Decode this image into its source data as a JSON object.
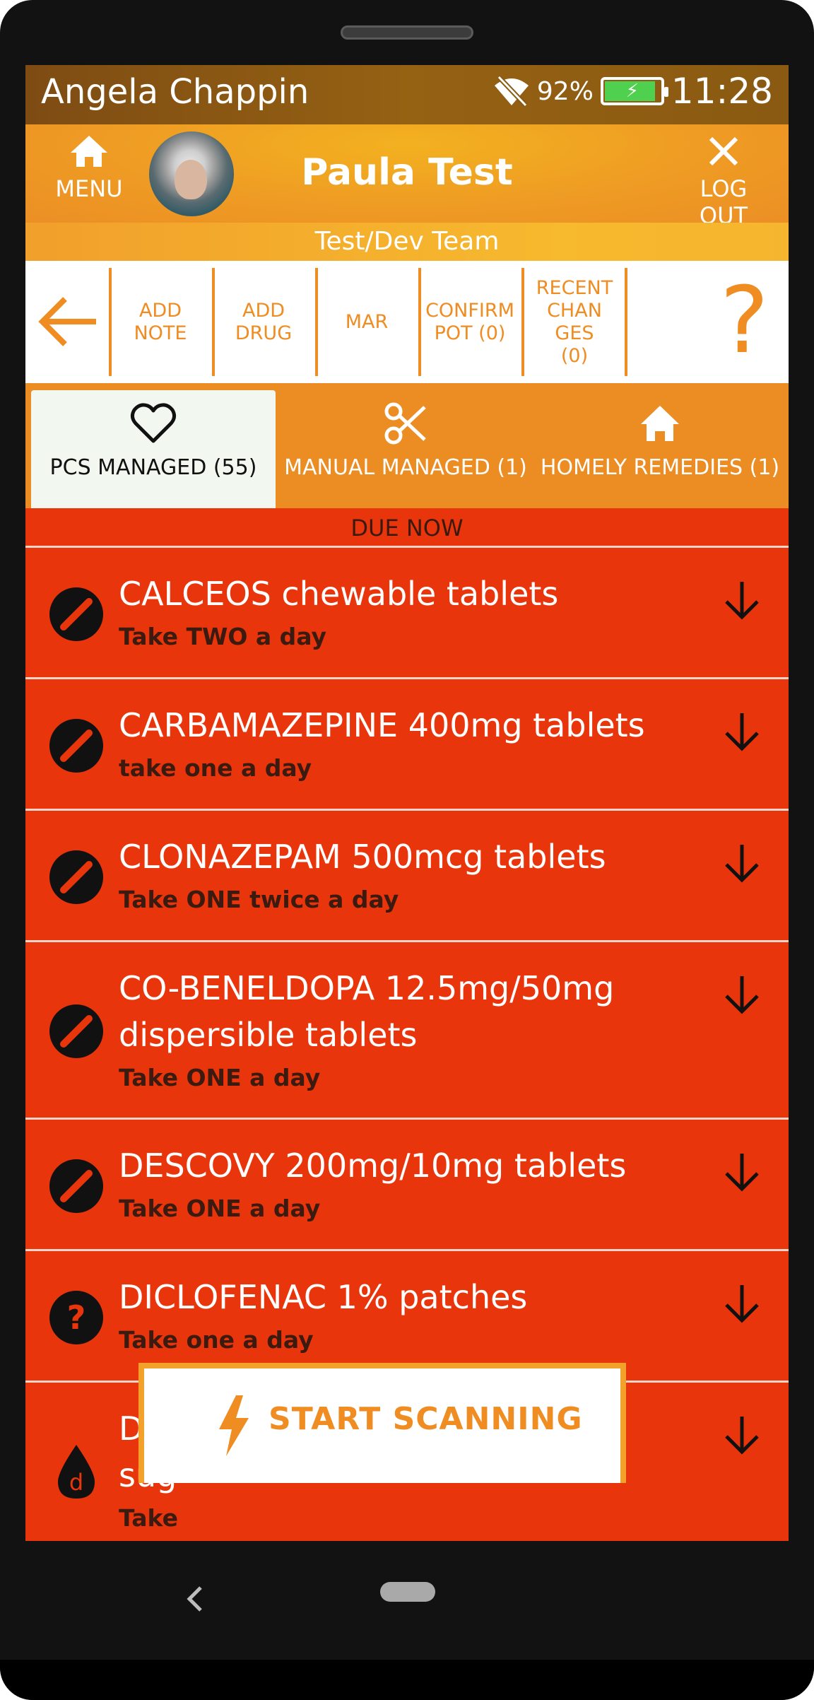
{
  "status_bar": {
    "user_name": "Angela Chappin",
    "battery_percent": "92%",
    "battery_level": 0.92,
    "time": "11:28",
    "icons": [
      "wifi-off-icon",
      "battery-charging-icon"
    ]
  },
  "header": {
    "menu_label": "MENU",
    "logout_label": "LOG OUT",
    "patient_name": "Paula Test",
    "team": "Test/Dev Team",
    "colors": {
      "accent": "#ef8c22",
      "header": "#ee9a24"
    }
  },
  "toolbar": {
    "items": [
      {
        "line1": "ADD",
        "line2": "NOTE",
        "line3": "",
        "line4": ""
      },
      {
        "line1": "ADD",
        "line2": "DRUG",
        "line3": "",
        "line4": ""
      },
      {
        "line1": "MAR",
        "line2": "",
        "line3": "",
        "line4": ""
      },
      {
        "line1": "CONFIRM",
        "line2": "POT (0)",
        "line3": "",
        "line4": ""
      },
      {
        "line1": "RECENT",
        "line2": "CHAN",
        "line3": "GES",
        "line4": "(0)"
      }
    ],
    "help": "?"
  },
  "tabs": [
    {
      "label": "PCS MANAGED (55)",
      "icon": "heart-icon",
      "active": true
    },
    {
      "label": "MANUAL MANAGED (1)",
      "icon": "scissors-icon",
      "active": false
    },
    {
      "label": "HOMELY REMEDIES (1)",
      "icon": "home-icon",
      "active": false
    }
  ],
  "section_title": "DUE NOW",
  "medications": [
    {
      "name_line1": "CALCEOS chewable tablets",
      "name_line2": "",
      "dose": "Take TWO a day",
      "icon": "tablet-icon"
    },
    {
      "name_line1": "CARBAMAZEPINE 400mg tablets",
      "name_line2": "",
      "dose": "take one a day",
      "icon": "tablet-icon"
    },
    {
      "name_line1": "CLONAZEPAM 500mcg tablets",
      "name_line2": "",
      "dose": "Take ONE twice a day",
      "icon": "tablet-icon"
    },
    {
      "name_line1": "CO-BENELDOPA 12.5mg/50mg",
      "name_line2": "dispersible tablets",
      "dose": "Take ONE a day",
      "icon": "tablet-icon"
    },
    {
      "name_line1": "DESCOVY 200mg/10mg tablets",
      "name_line2": "",
      "dose": "Take ONE a day",
      "icon": "tablet-icon"
    },
    {
      "name_line1": "DICLOFENAC 1% patches",
      "name_line2": "",
      "dose": "Take one a day",
      "icon": "question-icon"
    },
    {
      "name_line1": "DO",
      "name_line2": "sug",
      "dose": "Take",
      "icon": "drop-icon"
    }
  ],
  "scan_button": {
    "label": "START SCANNING"
  },
  "colors": {
    "due_background": "#e9350b",
    "scan_border": "#f2a12a"
  }
}
